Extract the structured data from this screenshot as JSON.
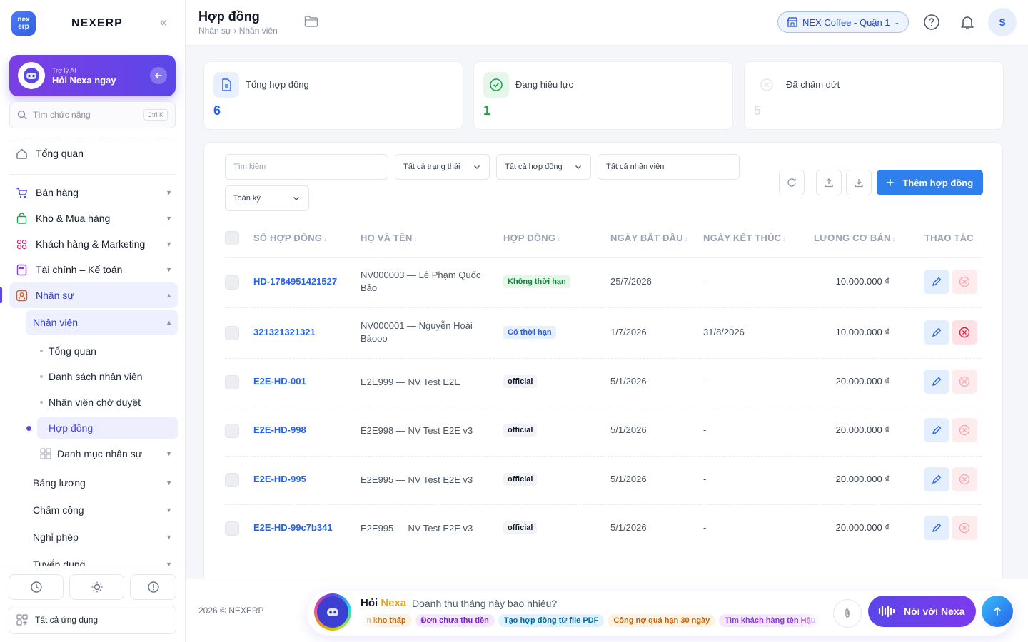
{
  "brand": {
    "name": "NEXERP",
    "logo_top": "nex",
    "logo_bottom": "erp"
  },
  "ai_card": {
    "small": "Trợ lý AI",
    "title": "Hỏi Nexa ngay"
  },
  "feature_search": {
    "placeholder": "Tìm chức năng",
    "shortcut": "Ctrl K"
  },
  "nav": {
    "overview": "Tổng quan",
    "sales": "Bán hàng",
    "warehouse": "Kho & Mua hàng",
    "customers": "Khách hàng & Marketing",
    "finance": "Tài chính – Kế toán",
    "hr": "Nhân sự",
    "hr_employees": "Nhân viên",
    "hr_leaves": [
      "Tổng quan",
      "Danh sách nhân viên",
      "Nhân viên chờ duyệt",
      "Hợp đồng"
    ],
    "hr_catalog": "Danh mục nhân sự",
    "payroll": "Bảng lương",
    "attendance": "Chấm công",
    "leave": "Nghỉ phép",
    "recruitment": "Tuyển dụng",
    "all_apps": "Tất cả ứng dụng"
  },
  "header": {
    "title": "Hợp đồng",
    "breadcrumb": "Nhân sự › Nhân viên",
    "store": "NEX Coffee - Quận 1",
    "user_initial": "S"
  },
  "stats": [
    {
      "label": "Tổng hợp đồng",
      "value": "6",
      "color": "#2563eb"
    },
    {
      "label": "Đang hiệu lực",
      "value": "1",
      "color": "#16a34a"
    },
    {
      "label": "Đã chấm dứt",
      "value": "5",
      "color": "#d9dde3"
    }
  ],
  "filters": {
    "search_placeholder": "Tìm kiếm",
    "status": "Tất cả trạng thái",
    "contract": "Tất cả hợp đồng",
    "employee": "Tất cả nhân viên",
    "period": "Toàn kỳ",
    "add_button": "Thêm hợp đồng"
  },
  "table": {
    "headers": [
      "SỐ HỢP ĐỒNG",
      "HỌ VÀ TÊN",
      "HỢP ĐỒNG",
      "NGÀY BẮT ĐẦU",
      "NGÀY KẾT THÚC",
      "LƯƠNG CƠ BẢN",
      "THAO TÁC"
    ],
    "rows": [
      {
        "number": "HD-1784951421527",
        "name": "NV000003 — Lê Phạm Quốc Bảo",
        "type": "Không thời hạn",
        "start": "25/7/2026",
        "end": "-",
        "salary": "10.000.000 ₫"
      },
      {
        "number": "321321321321",
        "name": "NV000001 — Nguyễn Hoài Bàooo",
        "type": "Có thời hạn",
        "start": "1/7/2026",
        "end": "31/8/2026",
        "salary": "10.000.000 ₫"
      },
      {
        "number": "E2E-HD-001",
        "name": "E2E999 — NV Test E2E",
        "type": "official",
        "start": "5/1/2026",
        "end": "-",
        "salary": "20.000.000 ₫"
      },
      {
        "number": "E2E-HD-998",
        "name": "E2E998 — NV Test E2E v3",
        "type": "official",
        "start": "5/1/2026",
        "end": "-",
        "salary": "20.000.000 ₫"
      },
      {
        "number": "E2E-HD-995",
        "name": "E2E995 — NV Test E2E v3",
        "type": "official",
        "start": "5/1/2026",
        "end": "-",
        "salary": "20.000.000 ₫"
      },
      {
        "number": "E2E-HD-99c7b341",
        "name": "E2E995 — NV Test E2E v3",
        "type": "official",
        "start": "5/1/2026",
        "end": "-",
        "salary": "20.000.000 ₫"
      }
    ]
  },
  "footer": {
    "copyright": "2026 © NEXERP",
    "nexa_prefix": "Hỏi",
    "nexa_name": "Nexa",
    "question": "Doanh thu tháng này bao nhiêu?",
    "chips": [
      "n kho thấp",
      "Đơn chưa thu tiền",
      "Tạo hợp đồng từ file PDF",
      "Công nợ quá hạn 30 ngày",
      "Tìm khách hàng tên Hậu"
    ],
    "voice_button": "Nói với Nexa"
  },
  "colors": {
    "accent": "#2f80ed",
    "ai_purple": "#5b46e8"
  }
}
